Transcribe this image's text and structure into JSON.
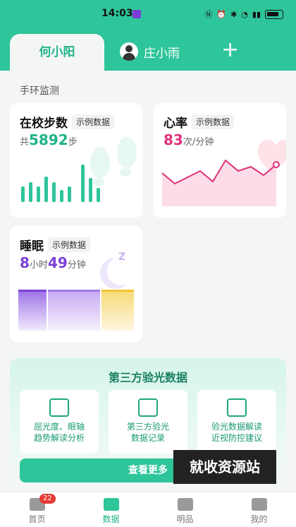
{
  "status": {
    "time": "14:03"
  },
  "tabs": {
    "active": "何小阳",
    "second": "庄小雨",
    "add_symbol": "+"
  },
  "section": {
    "title": "手环监测"
  },
  "steps": {
    "title": "在校步数",
    "tag": "示例数据",
    "prefix": "共",
    "value": "5892",
    "unit": "步"
  },
  "heart": {
    "title": "心率",
    "tag": "示例数据",
    "value": "83",
    "unit": "次/分钟"
  },
  "sleep": {
    "title": "睡眠",
    "tag": "示例数据",
    "hours": "8",
    "hours_unit": "小时",
    "minutes": "49",
    "minutes_unit": "分钟"
  },
  "evaluation": {
    "title": "第三方验光数据",
    "cards": [
      {
        "line1": "屈光度、眼轴",
        "line2": "趋势解读分析",
        "icon": "trend-icon"
      },
      {
        "line1": "第三方验光",
        "line2": "数据记录",
        "icon": "record-icon"
      },
      {
        "line1": "验光数据解读",
        "line2": "近视防控建议",
        "icon": "advice-icon"
      }
    ],
    "more_button": "查看更多"
  },
  "watermark": "就收资源站",
  "bottom_nav": [
    {
      "label": "首页",
      "badge": "22"
    },
    {
      "label": "数据"
    },
    {
      "label": "明品"
    },
    {
      "label": "我的"
    }
  ],
  "colors": {
    "primary": "#2ec59a",
    "heart": "#e0307a",
    "sleep": "#7b3fd6"
  },
  "step_chart": {
    "values": [
      0.4,
      0.5,
      0.4,
      0.65,
      0.5,
      0.3,
      0.4,
      0.95,
      0.6,
      0.35
    ]
  },
  "heart_chart": {
    "values": [
      0.55,
      0.3,
      0.45,
      0.6,
      0.35,
      0.85,
      0.6,
      0.7,
      0.5,
      0.75
    ]
  }
}
